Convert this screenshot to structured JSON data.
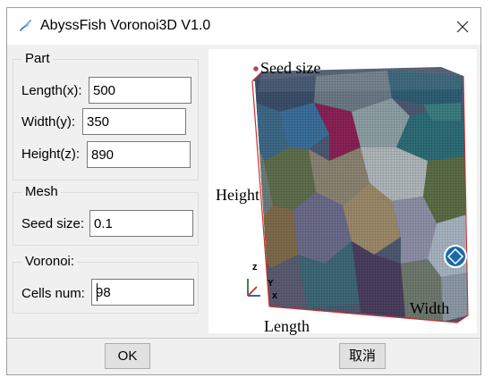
{
  "window": {
    "title": "AbyssFish Voronoi3D V1.0",
    "icon": "feather-pen-icon",
    "close_icon": "close-icon"
  },
  "part": {
    "title": "Part",
    "length_label": "Length(x):",
    "length_value": "500",
    "width_label": "Width(y):",
    "width_value": "350",
    "height_label": "Height(z):",
    "height_value": "890"
  },
  "mesh": {
    "title": "Mesh",
    "seed_label": "Seed size:",
    "seed_value": "0.1"
  },
  "voronoi": {
    "title": "Voronoi:",
    "cells_label": "Cells num:",
    "cells_value": "98"
  },
  "diagram": {
    "seed_size_label": "Seed size",
    "height_label": "Height",
    "length_label": "Length",
    "width_label": "Width",
    "axis_z": "z",
    "axis_y": "Y",
    "axis_x": "x",
    "edge_color": "#d42a2a"
  },
  "buttons": {
    "ok_label": "OK",
    "cancel_label": "取消"
  },
  "colors": {
    "window_bg": "#f0f0f0",
    "accent_blue": "#3f7dd6"
  }
}
